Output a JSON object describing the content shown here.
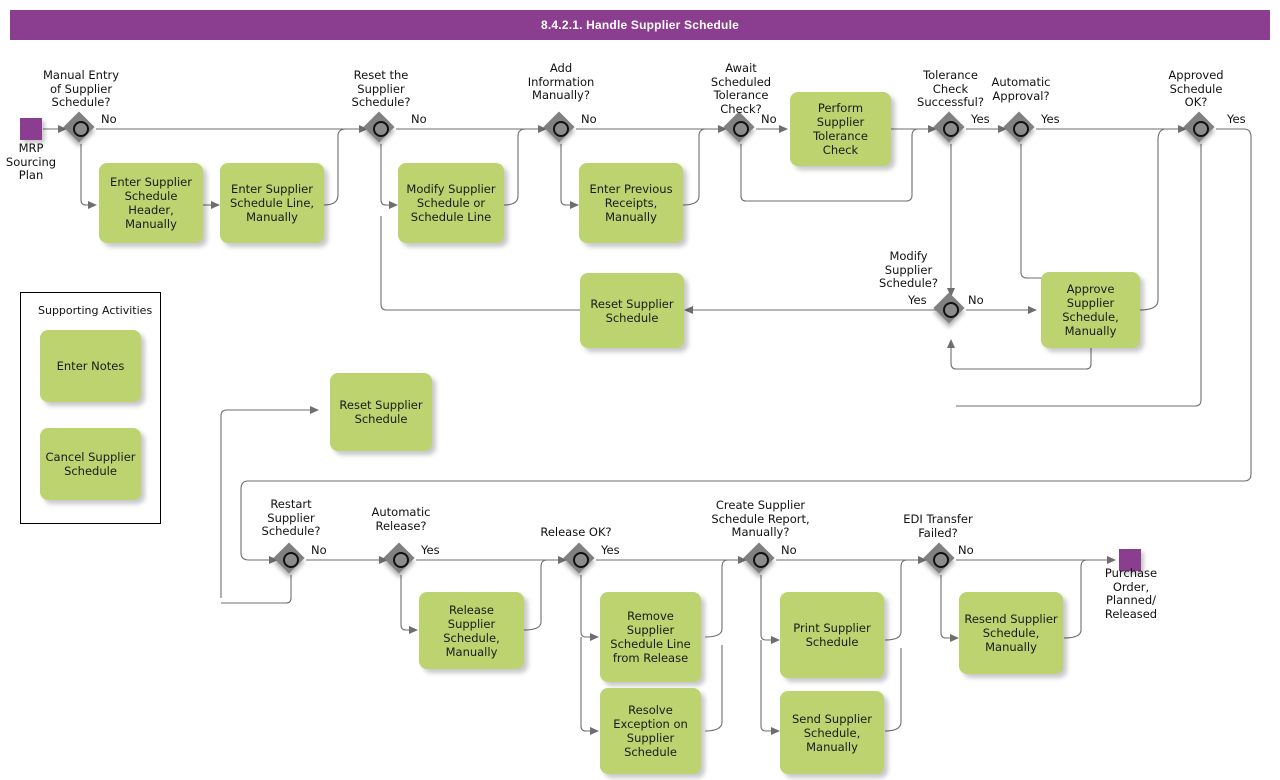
{
  "header": {
    "title": "8.4.2.1. Handle Supplier Schedule",
    "bar_color": "#8b3d8f"
  },
  "palette": {
    "task_fill": "#bcd36f",
    "gateway_fill": "#808080",
    "event_fill": "#8b3d8f",
    "line": "#6e6e6e"
  },
  "legend": {
    "title": "Supporting Activities"
  },
  "events": [
    {
      "name": "start-event",
      "label": "MRP\nSourcing\nPlan"
    },
    {
      "name": "end-event",
      "label": "Purchase\nOrder,\nPlanned/\nReleased"
    }
  ],
  "gateways": [
    {
      "id": "g1",
      "label": "Manual Entry\nof Supplier\nSchedule?",
      "flow": "No"
    },
    {
      "id": "g2",
      "label": "Reset the\nSupplier\nSchedule?",
      "flow": "No"
    },
    {
      "id": "g3",
      "label": "Add\nInformation\nManually?",
      "flow": "No"
    },
    {
      "id": "g4",
      "label": "Await\nScheduled\nTolerance\nCheck?",
      "flow": "No"
    },
    {
      "id": "g5",
      "label": "Tolerance\nCheck\nSuccessful?",
      "flow": "Yes"
    },
    {
      "id": "g6",
      "label": "Automatic\nApproval?",
      "flow": "Yes"
    },
    {
      "id": "g7",
      "label": "Approved\nSchedule\nOK?",
      "flow": "Yes"
    },
    {
      "id": "g8",
      "label": "Modify\nSupplier\nSchedule?",
      "flow": "No",
      "flow2": "Yes"
    },
    {
      "id": "g9",
      "label": "Restart\nSupplier\nSchedule?",
      "flow": "No"
    },
    {
      "id": "g10",
      "label": "Automatic\nRelease?",
      "flow": "Yes"
    },
    {
      "id": "g11",
      "label": "Release OK?",
      "flow": "Yes"
    },
    {
      "id": "g12",
      "label": "Create Supplier\nSchedule Report,\nManually?",
      "flow": "No"
    },
    {
      "id": "g13",
      "label": "EDI Transfer\nFailed?",
      "flow": "No"
    }
  ],
  "tasks": [
    {
      "id": "t1",
      "label": "Enter Supplier\nSchedule\nHeader,\nManually"
    },
    {
      "id": "t2",
      "label": "Enter Supplier\nSchedule Line,\nManually"
    },
    {
      "id": "t3",
      "label": "Modify Supplier\nSchedule or\nSchedule Line"
    },
    {
      "id": "t4",
      "label": "Enter Previous\nReceipts,\nManually"
    },
    {
      "id": "t5",
      "label": "Perform\nSupplier\nTolerance Check"
    },
    {
      "id": "t6",
      "label": "Approve\nSupplier\nSchedule,\nManually"
    },
    {
      "id": "t7",
      "label": "Reset Supplier\nSchedule"
    },
    {
      "id": "t8",
      "label": "Reset Supplier\nSchedule"
    },
    {
      "id": "t9",
      "label": "Release Supplier\nSchedule,\nManually"
    },
    {
      "id": "t10",
      "label": "Remove\nSupplier\nSchedule Line\nfrom Release"
    },
    {
      "id": "t11",
      "label": "Resolve\nException on\nSupplier\nSchedule"
    },
    {
      "id": "t12",
      "label": "Print Supplier\nSchedule"
    },
    {
      "id": "t13",
      "label": "Send Supplier\nSchedule,\nManually"
    },
    {
      "id": "t14",
      "label": "Resend Supplier\nSchedule,\nManually"
    },
    {
      "id": "t15",
      "label": "Enter Notes"
    },
    {
      "id": "t16",
      "label": "Cancel Supplier\nSchedule"
    }
  ]
}
